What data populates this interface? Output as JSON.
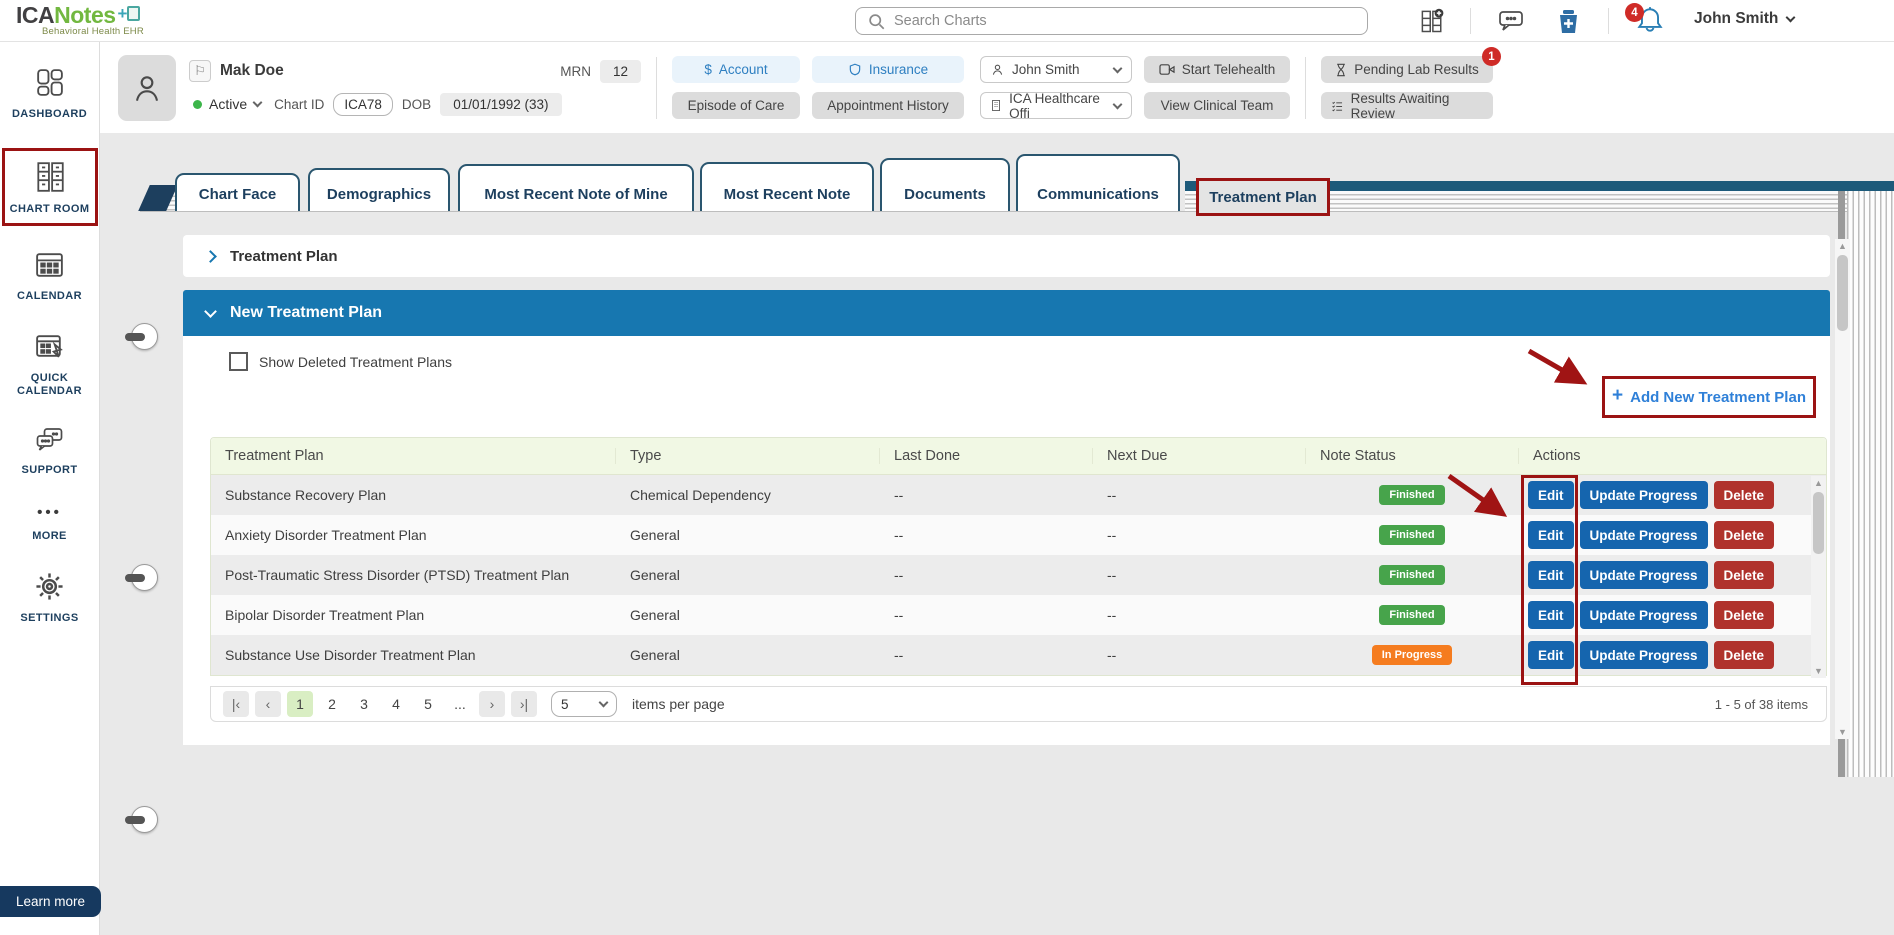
{
  "colors": {
    "accent_blue": "#1777b0",
    "highlight_red": "#9b1313",
    "action_blue": "#1565ae",
    "delete_red": "#b0322c",
    "finished_green": "#47a44b",
    "inprogress_orange": "#f57c1f",
    "brand_green": "#72b840",
    "brand_dark": "#414042",
    "teal_bar": "#1d5a7a",
    "header_green": "#f1f8e4"
  },
  "brand": {
    "name_a": "ICA",
    "name_b": "Notes",
    "tagline": "Behavioral Health EHR"
  },
  "topbar": {
    "search_placeholder": "Search Charts",
    "notification_count": "4",
    "user_name": "John Smith"
  },
  "sidebar": {
    "items": [
      "DASHBOARD",
      "CHART ROOM",
      "CALENDAR",
      "QUICK CALENDAR",
      "SUPPORT",
      "MORE",
      "SETTINGS"
    ],
    "learn_more": "Learn more"
  },
  "patient": {
    "name": "Mak Doe",
    "status_label": "Active",
    "chart_id_label": "Chart ID",
    "chart_id_value": "ICA78",
    "mrn_label": "MRN",
    "mrn_value": "12",
    "dob_label": "DOB",
    "dob_value": "01/01/1992 (33)",
    "account_label": "Account",
    "insurance_label": "Insurance",
    "episode_label": "Episode of Care",
    "appointment_history_label": "Appointment History",
    "provider_name": "John Smith",
    "office_name": "ICA Healthcare Offi",
    "telehealth_label": "Start Telehealth",
    "clinical_team_label": "View Clinical Team",
    "pending_labs_label": "Pending Lab Results",
    "pending_labs_count": "1",
    "results_review_label": "Results Awaiting Review"
  },
  "tabs": {
    "items": [
      "Chart Face",
      "Demographics",
      "Most Recent Note of Mine",
      "Most Recent Note",
      "Documents",
      "Communications"
    ],
    "active_tab": "Treatment Plan"
  },
  "panel": {
    "collapsed_title": "Treatment Plan",
    "expanded_title": "New Treatment Plan",
    "show_deleted_label": "Show Deleted Treatment Plans",
    "add_button_label": "Add New Treatment Plan"
  },
  "table": {
    "columns": [
      "Treatment Plan",
      "Type",
      "Last Done",
      "Next Due",
      "Note Status",
      "Actions"
    ],
    "rows": [
      {
        "plan": "Substance Recovery Plan",
        "type": "Chemical Dependency",
        "last_done": "--",
        "next_due": "--",
        "status": "Finished"
      },
      {
        "plan": "Anxiety Disorder Treatment Plan",
        "type": "General",
        "last_done": "--",
        "next_due": "--",
        "status": "Finished"
      },
      {
        "plan": "Post-Traumatic Stress Disorder (PTSD) Treatment Plan",
        "type": "General",
        "last_done": "--",
        "next_due": "--",
        "status": "Finished"
      },
      {
        "plan": "Bipolar Disorder Treatment Plan",
        "type": "General",
        "last_done": "--",
        "next_due": "--",
        "status": "Finished"
      },
      {
        "plan": "Substance Use Disorder Treatment Plan",
        "type": "General",
        "last_done": "--",
        "next_due": "--",
        "status": "In Progress"
      }
    ],
    "actions": [
      "Edit",
      "Update Progress",
      "Delete"
    ]
  },
  "pagination": {
    "first": "|‹",
    "prev": "‹",
    "pages": [
      "1",
      "2",
      "3",
      "4",
      "5"
    ],
    "current_page": "1",
    "ellipsis": "...",
    "next": "›",
    "last": "›|",
    "page_size": "5",
    "items_per_page_label": "items per page",
    "range_label": "1 - 5 of 38 items"
  },
  "glyphs": {
    "dollar": "$",
    "flag": "⚐",
    "plus": "+",
    "dots_more": "•••",
    "scroll_up": "▲",
    "scroll_down": "▼"
  }
}
